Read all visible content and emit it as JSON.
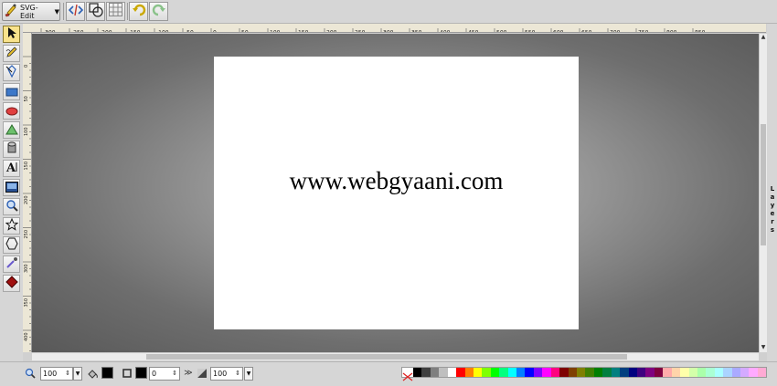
{
  "app": {
    "name": "SVG-Edit"
  },
  "canvas": {
    "text": "www.webgyaani.com"
  },
  "ruler": {
    "top_labels": [
      "-300",
      "-250",
      "-200",
      "-150",
      "-100",
      "-50",
      "0",
      "50",
      "100",
      "150",
      "200",
      "250",
      "300",
      "350",
      "400",
      "450",
      "500",
      "550",
      "600",
      "650",
      "700",
      "750",
      "800",
      "850"
    ],
    "left_labels": [
      "0",
      "50",
      "100",
      "150",
      "200",
      "250",
      "300",
      "350",
      "400",
      "450"
    ]
  },
  "layers_panel": {
    "label": "Layers"
  },
  "bottom": {
    "zoom_value": "100",
    "stroke_width": "0",
    "opacity_value": "100"
  },
  "colors": {
    "fill": "#000000",
    "stroke": "#000000",
    "palette": [
      "#000000",
      "#3f3f3f",
      "#7f7f7f",
      "#bfbfbf",
      "#ffffff",
      "#ff0000",
      "#ff7f00",
      "#ffff00",
      "#7fff00",
      "#00ff00",
      "#00ff7f",
      "#00ffff",
      "#007fff",
      "#0000ff",
      "#7f00ff",
      "#ff00ff",
      "#ff007f",
      "#7f0000",
      "#7f3f00",
      "#7f7f00",
      "#3f7f00",
      "#007f00",
      "#007f3f",
      "#007f7f",
      "#003f7f",
      "#00007f",
      "#3f007f",
      "#7f007f",
      "#7f003f",
      "#ffaaaa",
      "#ffd4aa",
      "#ffffaa",
      "#d4ffaa",
      "#aaffaa",
      "#aaffd4",
      "#aaffff",
      "#aad4ff",
      "#aaaaff",
      "#d4aaff",
      "#ffaaff",
      "#ffaad4"
    ]
  },
  "icons": {
    "toolbar": [
      "svg-edit-logo-icon",
      "source-icon",
      "wireframe-icon",
      "grid-icon",
      "undo-icon",
      "redo-icon"
    ],
    "tools": [
      "select-icon",
      "pencil-icon",
      "path-icon",
      "rectangle-icon",
      "ellipse-icon",
      "polygon-icon",
      "cylinder-icon",
      "text-icon",
      "image-icon",
      "zoom-icon",
      "star-icon",
      "shape-library-icon",
      "eyedropper-icon",
      "fill-bucket-icon"
    ]
  }
}
